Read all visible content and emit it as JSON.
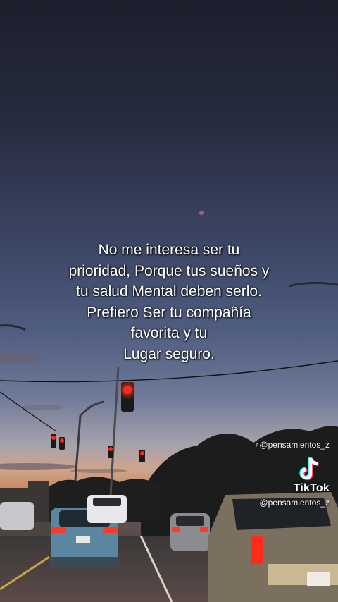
{
  "caption": {
    "lines": [
      "No me interesa ser tu",
      "prioridad, Porque tus sueños y",
      "tu salud Mental deben serlo.",
      "Prefiero Ser tu compañía",
      "favorita y tu",
      "Lugar seguro."
    ]
  },
  "watermark": {
    "top_handle": "@pensamientos_z",
    "brand": "TikTok",
    "handle": "@pensamientos_z",
    "logo_icon": "tiktok-logo-icon"
  },
  "colors": {
    "sky_top": "#1c1f2c",
    "sky_mid": "#4a5a7e",
    "horizon_orange": "#d0956a",
    "red_light": "#ff2a1a"
  }
}
